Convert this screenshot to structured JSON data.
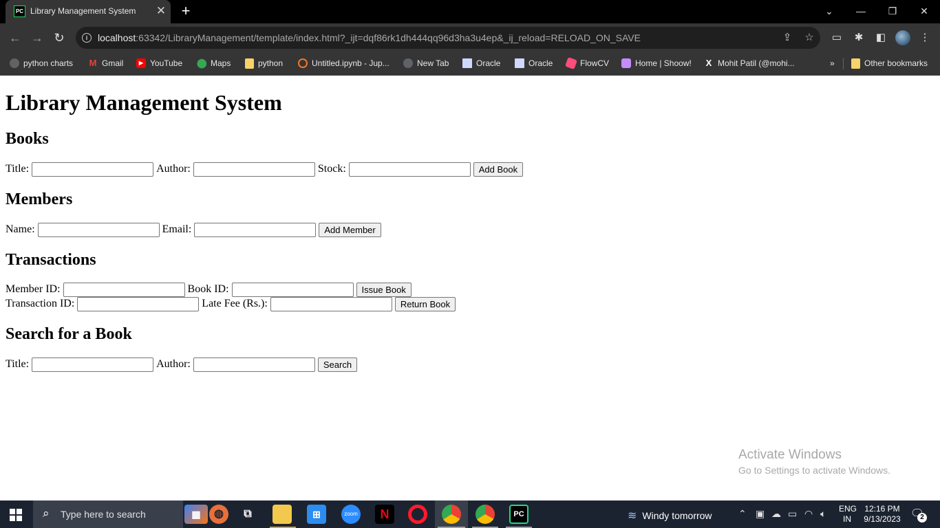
{
  "browser": {
    "tab_title": "Library Management System",
    "tab_favicon_text": "PC",
    "close_glyph": "✕",
    "newtab_glyph": "+",
    "url_host": "localhost",
    "url_rest": ":63342/LibraryManagement/template/index.html?_ijt=dqf86rk1dh444qq96d3ha3u4ep&_ij_reload=RELOAD_ON_SAVE",
    "bookmarks": [
      {
        "label": "python charts",
        "icon": "globe-icon",
        "color": "#e0e0e0"
      },
      {
        "label": "Gmail",
        "icon": "gmail-icon",
        "color": "#ea4335"
      },
      {
        "label": "YouTube",
        "icon": "youtube-icon",
        "color": "#ff0000"
      },
      {
        "label": "Maps",
        "icon": "maps-icon",
        "color": "#34a853"
      },
      {
        "label": "python",
        "icon": "folder-icon",
        "color": "#f7d36b"
      },
      {
        "label": "Untitled.ipynb - Jup...",
        "icon": "jupyter-icon",
        "color": "#f37726"
      },
      {
        "label": "New Tab",
        "icon": "globe-icon",
        "color": "#e0e0e0"
      },
      {
        "label": "Oracle",
        "icon": "page-icon",
        "color": "#cfd8ff"
      },
      {
        "label": "Oracle",
        "icon": "page-icon",
        "color": "#cfd8ff"
      },
      {
        "label": "FlowCV",
        "icon": "flowcv-icon",
        "color": "#ff4d7a"
      },
      {
        "label": "Home | Shoow!",
        "icon": "shoow-icon",
        "color": "#c58cff"
      },
      {
        "label": "Mohit Patil (@mohi...",
        "icon": "x-icon",
        "color": "#ffffff"
      }
    ],
    "bookmarks_overflow": "»",
    "other_bookmarks": "Other bookmarks"
  },
  "page": {
    "title": "Library Management System",
    "books": {
      "heading": "Books",
      "title_label": "Title:",
      "author_label": "Author:",
      "stock_label": "Stock:",
      "add_button": "Add Book"
    },
    "members": {
      "heading": "Members",
      "name_label": "Name:",
      "email_label": "Email:",
      "add_button": "Add Member"
    },
    "transactions": {
      "heading": "Transactions",
      "member_id_label": "Member ID:",
      "book_id_label": "Book ID:",
      "issue_button": "Issue Book",
      "transaction_id_label": "Transaction ID:",
      "late_fee_label": "Late Fee (Rs.):",
      "return_button": "Return Book"
    },
    "search": {
      "heading": "Search for a Book",
      "title_label": "Title:",
      "author_label": "Author:",
      "search_button": "Search"
    }
  },
  "watermark": {
    "line1": "Activate Windows",
    "line2": "Go to Settings to activate Windows."
  },
  "taskbar": {
    "search_placeholder": "Type here to search",
    "weather": "Windy tomorrow",
    "lang_top": "ENG",
    "lang_bottom": "IN",
    "time": "12:16 PM",
    "date": "9/13/2023",
    "notification_count": "2",
    "zoom_label": "zoom",
    "netflix_label": "N",
    "pycharm_label": "PC"
  }
}
